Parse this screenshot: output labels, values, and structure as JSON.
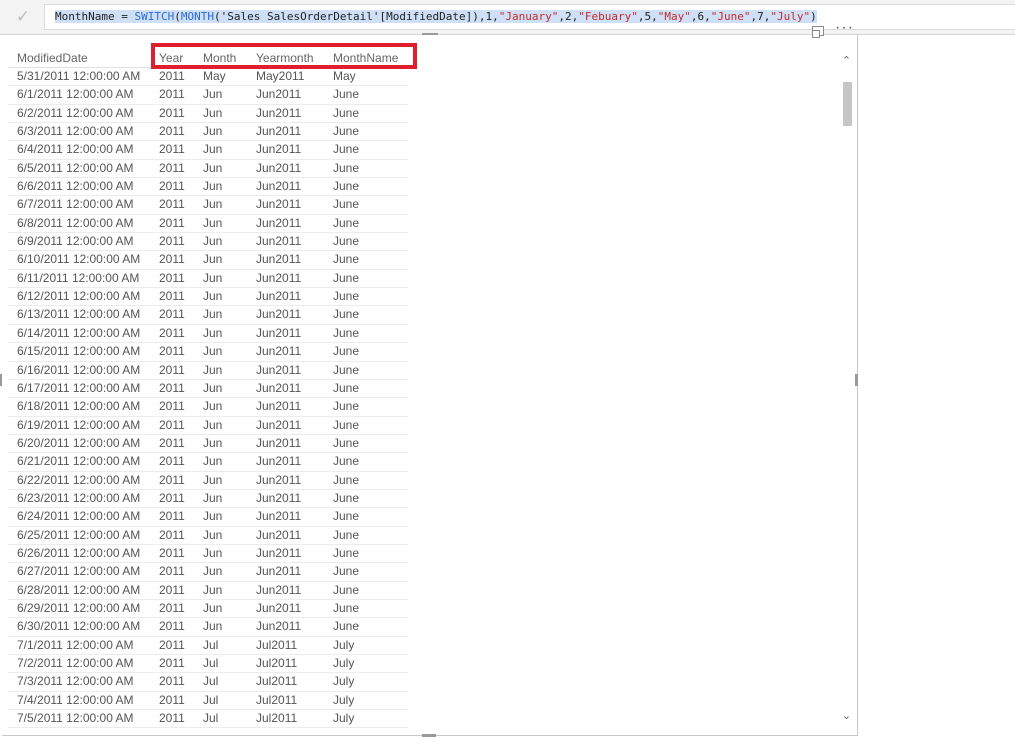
{
  "formula_bar": {
    "check_glyph": "✓",
    "tokens": [
      {
        "text": "MonthName = ",
        "kind": "text"
      },
      {
        "text": "SWITCH",
        "kind": "fn"
      },
      {
        "text": "(",
        "kind": "text"
      },
      {
        "text": "MONTH",
        "kind": "fn"
      },
      {
        "text": "('Sales SalesOrderDetail'[ModifiedDate]),1,",
        "kind": "text"
      },
      {
        "text": "\"January\"",
        "kind": "str"
      },
      {
        "text": ",2,",
        "kind": "text"
      },
      {
        "text": "\"Febuary\"",
        "kind": "str"
      },
      {
        "text": ",5,",
        "kind": "text"
      },
      {
        "text": "\"May\"",
        "kind": "str"
      },
      {
        "text": ",6,",
        "kind": "text"
      },
      {
        "text": "\"June\"",
        "kind": "str"
      },
      {
        "text": ",7,",
        "kind": "text"
      },
      {
        "text": "\"July\"",
        "kind": "str"
      },
      {
        "text": ")",
        "kind": "text"
      }
    ]
  },
  "visual": {
    "more_options": "···",
    "focus_icon": "focus-mode-icon"
  },
  "table": {
    "headers": [
      "ModifiedDate",
      "Year",
      "Month",
      "Yearmonth",
      "MonthName"
    ],
    "rows": [
      [
        "5/31/2011 12:00:00 AM",
        "2011",
        "May",
        "May2011",
        "May"
      ],
      [
        "6/1/2011 12:00:00 AM",
        "2011",
        "Jun",
        "Jun2011",
        "June"
      ],
      [
        "6/2/2011 12:00:00 AM",
        "2011",
        "Jun",
        "Jun2011",
        "June"
      ],
      [
        "6/3/2011 12:00:00 AM",
        "2011",
        "Jun",
        "Jun2011",
        "June"
      ],
      [
        "6/4/2011 12:00:00 AM",
        "2011",
        "Jun",
        "Jun2011",
        "June"
      ],
      [
        "6/5/2011 12:00:00 AM",
        "2011",
        "Jun",
        "Jun2011",
        "June"
      ],
      [
        "6/6/2011 12:00:00 AM",
        "2011",
        "Jun",
        "Jun2011",
        "June"
      ],
      [
        "6/7/2011 12:00:00 AM",
        "2011",
        "Jun",
        "Jun2011",
        "June"
      ],
      [
        "6/8/2011 12:00:00 AM",
        "2011",
        "Jun",
        "Jun2011",
        "June"
      ],
      [
        "6/9/2011 12:00:00 AM",
        "2011",
        "Jun",
        "Jun2011",
        "June"
      ],
      [
        "6/10/2011 12:00:00 AM",
        "2011",
        "Jun",
        "Jun2011",
        "June"
      ],
      [
        "6/11/2011 12:00:00 AM",
        "2011",
        "Jun",
        "Jun2011",
        "June"
      ],
      [
        "6/12/2011 12:00:00 AM",
        "2011",
        "Jun",
        "Jun2011",
        "June"
      ],
      [
        "6/13/2011 12:00:00 AM",
        "2011",
        "Jun",
        "Jun2011",
        "June"
      ],
      [
        "6/14/2011 12:00:00 AM",
        "2011",
        "Jun",
        "Jun2011",
        "June"
      ],
      [
        "6/15/2011 12:00:00 AM",
        "2011",
        "Jun",
        "Jun2011",
        "June"
      ],
      [
        "6/16/2011 12:00:00 AM",
        "2011",
        "Jun",
        "Jun2011",
        "June"
      ],
      [
        "6/17/2011 12:00:00 AM",
        "2011",
        "Jun",
        "Jun2011",
        "June"
      ],
      [
        "6/18/2011 12:00:00 AM",
        "2011",
        "Jun",
        "Jun2011",
        "June"
      ],
      [
        "6/19/2011 12:00:00 AM",
        "2011",
        "Jun",
        "Jun2011",
        "June"
      ],
      [
        "6/20/2011 12:00:00 AM",
        "2011",
        "Jun",
        "Jun2011",
        "June"
      ],
      [
        "6/21/2011 12:00:00 AM",
        "2011",
        "Jun",
        "Jun2011",
        "June"
      ],
      [
        "6/22/2011 12:00:00 AM",
        "2011",
        "Jun",
        "Jun2011",
        "June"
      ],
      [
        "6/23/2011 12:00:00 AM",
        "2011",
        "Jun",
        "Jun2011",
        "June"
      ],
      [
        "6/24/2011 12:00:00 AM",
        "2011",
        "Jun",
        "Jun2011",
        "June"
      ],
      [
        "6/25/2011 12:00:00 AM",
        "2011",
        "Jun",
        "Jun2011",
        "June"
      ],
      [
        "6/26/2011 12:00:00 AM",
        "2011",
        "Jun",
        "Jun2011",
        "June"
      ],
      [
        "6/27/2011 12:00:00 AM",
        "2011",
        "Jun",
        "Jun2011",
        "June"
      ],
      [
        "6/28/2011 12:00:00 AM",
        "2011",
        "Jun",
        "Jun2011",
        "June"
      ],
      [
        "6/29/2011 12:00:00 AM",
        "2011",
        "Jun",
        "Jun2011",
        "June"
      ],
      [
        "6/30/2011 12:00:00 AM",
        "2011",
        "Jun",
        "Jun2011",
        "June"
      ],
      [
        "7/1/2011 12:00:00 AM",
        "2011",
        "Jul",
        "Jul2011",
        "July"
      ],
      [
        "7/2/2011 12:00:00 AM",
        "2011",
        "Jul",
        "Jul2011",
        "July"
      ],
      [
        "7/3/2011 12:00:00 AM",
        "2011",
        "Jul",
        "Jul2011",
        "July"
      ],
      [
        "7/4/2011 12:00:00 AM",
        "2011",
        "Jul",
        "Jul2011",
        "July"
      ],
      [
        "7/5/2011 12:00:00 AM",
        "2011",
        "Jul",
        "Jul2011",
        "July"
      ]
    ]
  },
  "scrollbar": {
    "up_glyph": "⌃",
    "down_glyph": "⌄"
  },
  "colors": {
    "highlight_border": "#e01e2e",
    "formula_function": "#2a6bd8",
    "formula_string": "#c22b2b"
  }
}
